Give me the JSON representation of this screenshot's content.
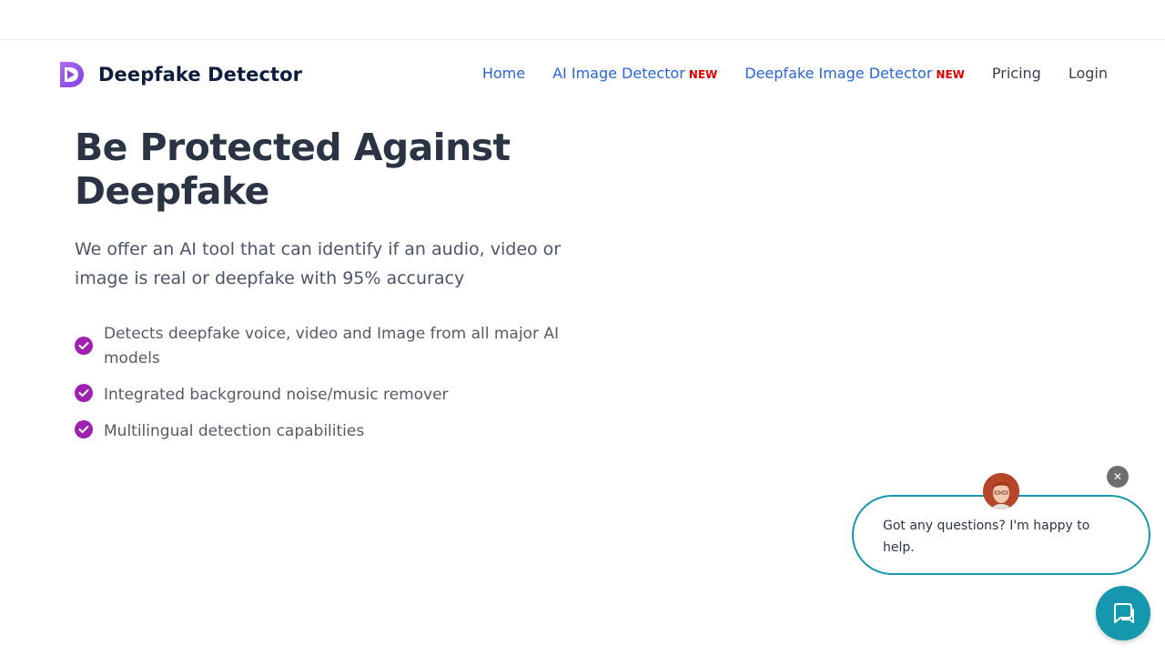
{
  "brand": {
    "name": "Deepfake Detector",
    "accent_color": "#a020b0"
  },
  "nav": {
    "items": [
      {
        "label": "Home",
        "badge": ""
      },
      {
        "label": "AI Image Detector",
        "badge": "NEW"
      },
      {
        "label": "Deepfake Image Detector",
        "badge": "NEW"
      },
      {
        "label": "Pricing",
        "badge": ""
      },
      {
        "label": "Login",
        "badge": ""
      }
    ],
    "link_color": "#2864d8",
    "badge_color": "#e00000"
  },
  "hero": {
    "title": "Be Protected Against Deepfake",
    "subtitle": "We offer an AI tool that can identify if an audio, video or image is real or deepfake with 95% accuracy",
    "features": [
      "Detects deepfake voice, video and Image from all major AI models",
      "Integrated background noise/music remover",
      "Multilingual detection capabilities"
    ]
  },
  "chat": {
    "message": "Got any questions? I'm happy to help.",
    "close_icon": "close-icon",
    "launcher_icon": "chat-icon",
    "color": "#1597ad"
  }
}
